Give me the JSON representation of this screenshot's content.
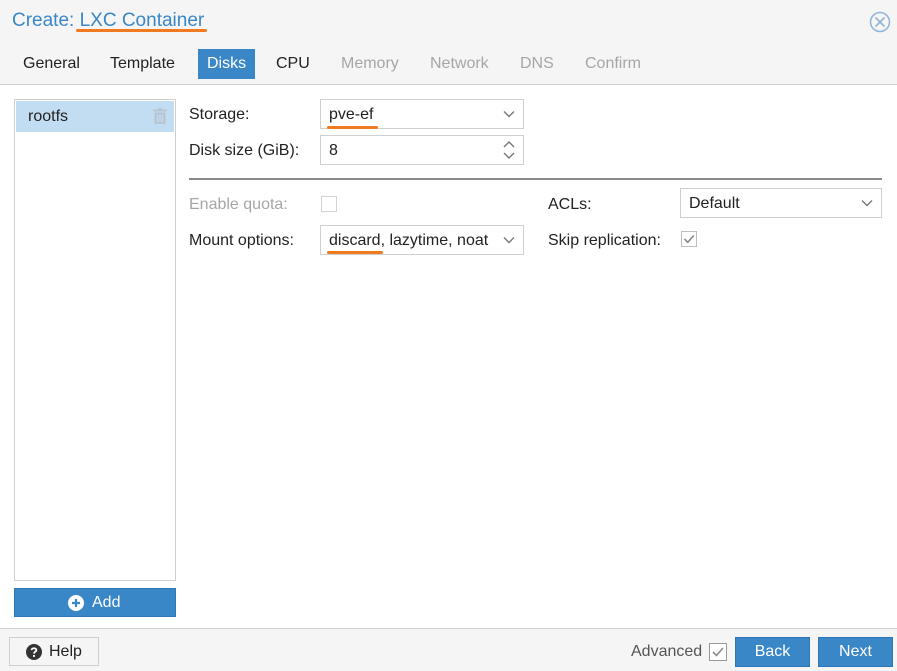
{
  "window": {
    "title_prefix": "Create: ",
    "title_main": "LXC Container",
    "close_icon": "close-circle-icon"
  },
  "tabs": [
    {
      "label": "General",
      "state": "normal"
    },
    {
      "label": "Template",
      "state": "normal"
    },
    {
      "label": "Disks",
      "state": "active"
    },
    {
      "label": "CPU",
      "state": "normal"
    },
    {
      "label": "Memory",
      "state": "disabled"
    },
    {
      "label": "Network",
      "state": "disabled"
    },
    {
      "label": "DNS",
      "state": "disabled"
    },
    {
      "label": "Confirm",
      "state": "disabled"
    }
  ],
  "disks": {
    "items": [
      {
        "label": "rootfs",
        "selected": true
      }
    ],
    "add_label": "Add"
  },
  "form": {
    "storage_label": "Storage:",
    "storage_value": "pve-ef",
    "disk_size_label": "Disk size (GiB):",
    "disk_size_value": "8",
    "enable_quota_label": "Enable quota:",
    "enable_quota_checked": false,
    "mount_options_label": "Mount options:",
    "mount_options_value": "discard, lazytime, noat",
    "acls_label": "ACLs:",
    "acls_value": "Default",
    "skip_replication_label": "Skip replication:",
    "skip_replication_checked": true
  },
  "footer": {
    "help_label": "Help",
    "advanced_label": "Advanced",
    "advanced_checked": true,
    "back_label": "Back",
    "next_label": "Next"
  },
  "colors": {
    "accent": "#3a87c8",
    "selected_row": "#c2ddf2",
    "annotation": "#f07a1f",
    "disabled_text": "#a6a6a6"
  }
}
